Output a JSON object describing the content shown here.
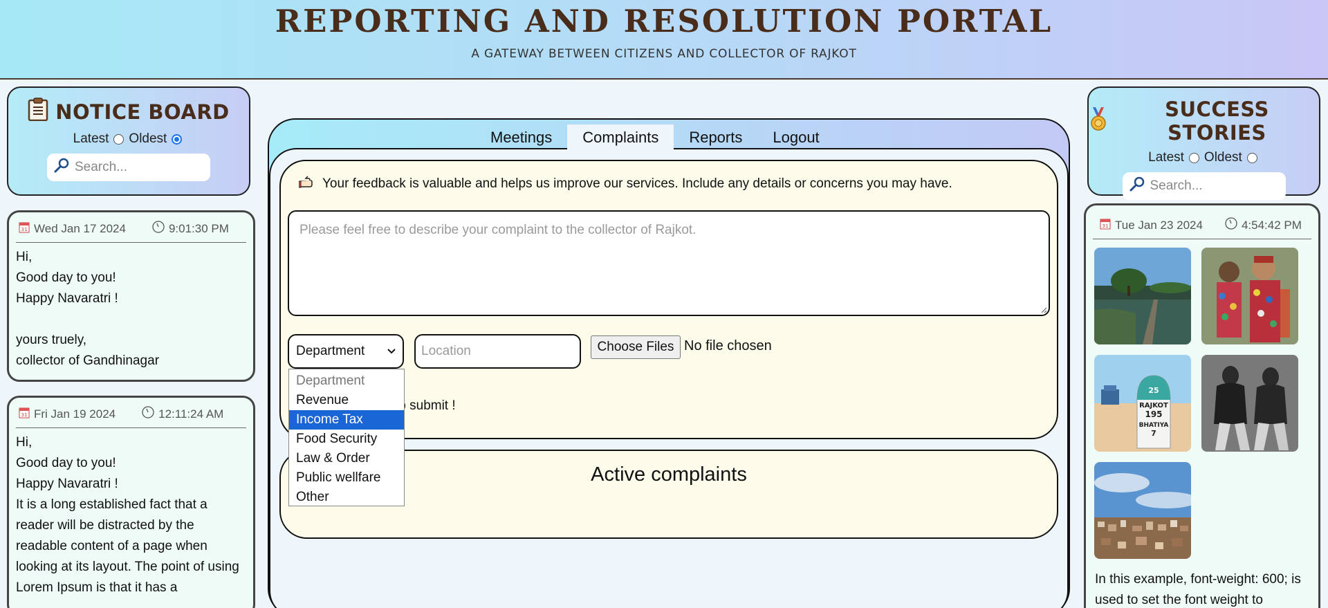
{
  "header": {
    "title": "REPORTING AND RESOLUTION PORTAL",
    "subtitle": "A GATEWAY BETWEEN CITIZENS AND COLLECTOR OF RAJKOT"
  },
  "notice_board": {
    "title": "NOTICE BOARD",
    "sort_latest": "Latest",
    "sort_oldest": "Oldest",
    "selected_sort": "Oldest",
    "search_placeholder": "Search...",
    "notices": [
      {
        "date": "Wed Jan 17 2024",
        "time": "9:01:30 PM",
        "body": "Hi,\nGood day to you!\nHappy Navaratri !\n\nyours truely,\ncollector of Gandhinagar"
      },
      {
        "date": "Fri Jan 19 2024",
        "time": "12:11:24 AM",
        "body": "Hi,\nGood day to you!\nHappy Navaratri !\nIt is a long established fact that a reader will be distracted by the readable content of a page when looking at its layout. The point of using Lorem Ipsum is that it has a"
      }
    ]
  },
  "nav": {
    "tabs": [
      {
        "label": "Meetings"
      },
      {
        "label": "Complaints"
      },
      {
        "label": "Reports"
      },
      {
        "label": "Logout"
      }
    ],
    "active_tab": "Complaints"
  },
  "complaint_form": {
    "feedback_text": "Your feedback is valuable and helps us improve our services. Include any details or concerns you may have.",
    "textarea_placeholder": "Please feel free to describe your complaint to the collector of Rajkot.",
    "department_value": "Department",
    "department_options": [
      "Department",
      "Revenue",
      "Income Tax",
      "Food Security",
      "Law & Order",
      "Public wellfare",
      "Other"
    ],
    "department_highlighted": "Income Tax",
    "location_placeholder": "Location",
    "file_button": "Choose Files",
    "file_status": "No file chosen",
    "submit_hint": "ls to submit !"
  },
  "active_complaints": {
    "title": "Active complaints"
  },
  "success_stories": {
    "title": "SUCCESS STORIES",
    "sort_latest": "Latest",
    "sort_oldest": "Oldest",
    "search_placeholder": "Search...",
    "story": {
      "date": "Tue Jan 23 2024",
      "time": "4:54:42 PM",
      "images": [
        "lake-path-photo",
        "tribal-dolls-photo",
        "rajkot-milestone-photo",
        "historic-portrait-photo",
        "city-skyline-photo"
      ],
      "milestone_text": [
        "25",
        "RAJKOT",
        "195",
        "BHATIYA",
        "7"
      ],
      "text": "In this example, font-weight: 600; is used to set the font weight to"
    }
  },
  "colors": {
    "header_gradient_start": "#a6e8f6",
    "header_gradient_end": "#c9c6f6",
    "title_brown": "#4a2c1a",
    "form_bg": "#fdfbea",
    "card_bg": "#effbf7",
    "highlight_blue": "#1a66d6"
  }
}
